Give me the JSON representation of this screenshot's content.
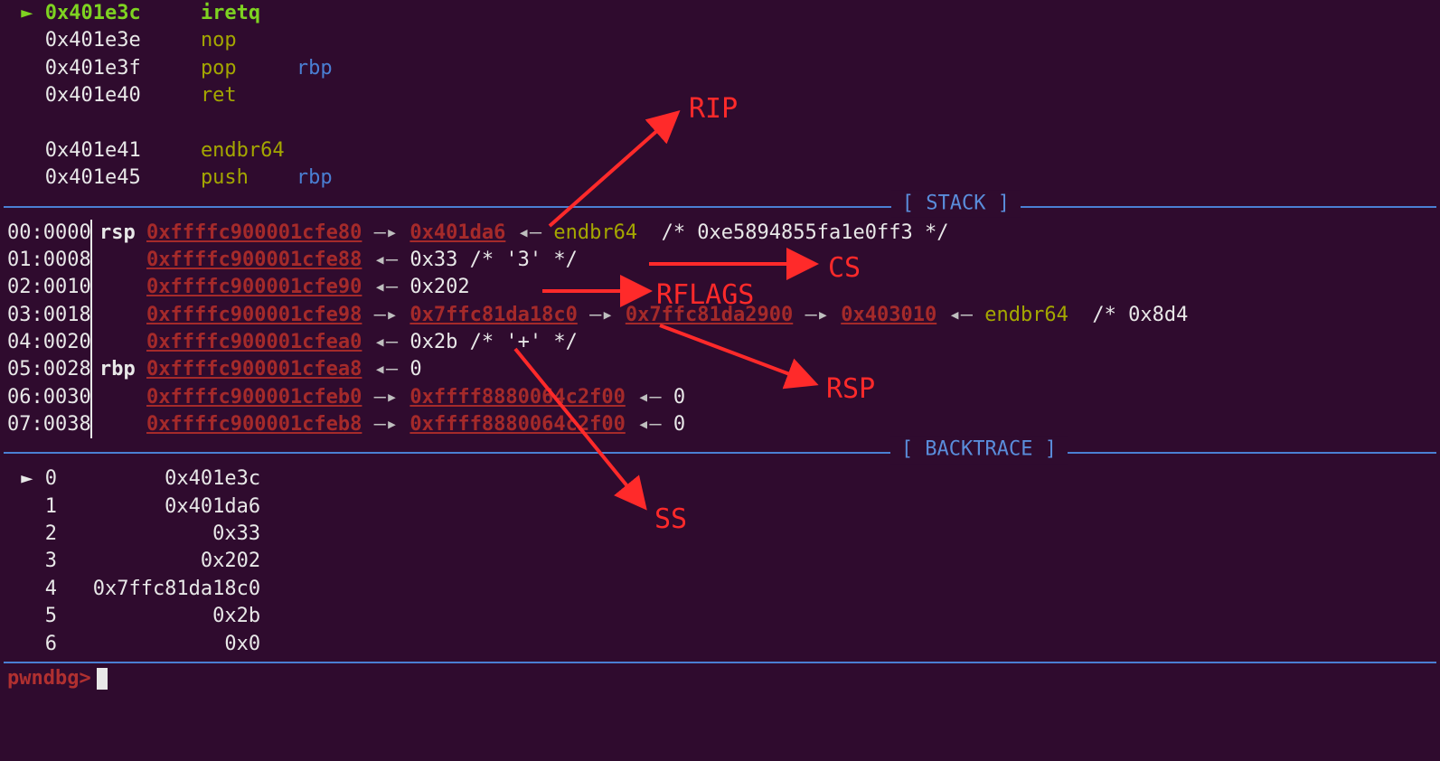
{
  "disasm": [
    {
      "marker": "►",
      "addr": "0x401e3c",
      "mnemonic": "iretq",
      "op": "",
      "current": true
    },
    {
      "marker": " ",
      "addr": "0x401e3e",
      "mnemonic": "nop",
      "op": "",
      "current": false
    },
    {
      "marker": " ",
      "addr": "0x401e3f",
      "mnemonic": "pop",
      "op": "rbp",
      "current": false
    },
    {
      "marker": " ",
      "addr": "0x401e40",
      "mnemonic": "ret",
      "op": "",
      "current": false
    },
    {
      "blank": true
    },
    {
      "marker": " ",
      "addr": "0x401e41",
      "mnemonic": "endbr64",
      "op": "",
      "current": false
    },
    {
      "marker": " ",
      "addr": "0x401e45",
      "mnemonic": "push",
      "op": "rbp",
      "current": false
    }
  ],
  "sections": {
    "stack_label": "[ STACK ]",
    "backtrace_label": "[ BACKTRACE ]"
  },
  "stack": [
    {
      "idx": "00:0000",
      "reg": "rsp",
      "addr": "0xffffc900001cfe80",
      "chain": [
        {
          "arrow": "—▸",
          "link": "0x401da6"
        },
        {
          "arrow": "◂—",
          "olive": "endbr64 ",
          "comment": " /* 0xe5894855fa1e0ff3 */"
        }
      ]
    },
    {
      "idx": "01:0008",
      "reg": "",
      "addr": "0xffffc900001cfe88",
      "chain": [
        {
          "arrow": "◂—",
          "text": "0x33 /* '3' */"
        }
      ]
    },
    {
      "idx": "02:0010",
      "reg": "",
      "addr": "0xffffc900001cfe90",
      "chain": [
        {
          "arrow": "◂—",
          "text": "0x202"
        }
      ]
    },
    {
      "idx": "03:0018",
      "reg": "",
      "addr": "0xffffc900001cfe98",
      "chain": [
        {
          "arrow": "—▸",
          "link": "0x7ffc81da18c0"
        },
        {
          "arrow": "—▸",
          "link": "0x7ffc81da2900"
        },
        {
          "arrow": "—▸",
          "link": "0x403010"
        },
        {
          "arrow": "◂—",
          "olive": "endbr64 ",
          "comment": " /* 0x8d4"
        }
      ]
    },
    {
      "idx": "04:0020",
      "reg": "",
      "addr": "0xffffc900001cfea0",
      "chain": [
        {
          "arrow": "◂—",
          "text": "0x2b /* '+' */"
        }
      ]
    },
    {
      "idx": "05:0028",
      "reg": "rbp",
      "addr": "0xffffc900001cfea8",
      "chain": [
        {
          "arrow": "◂—",
          "text": "0"
        }
      ]
    },
    {
      "idx": "06:0030",
      "reg": "",
      "addr": "0xffffc900001cfeb0",
      "chain": [
        {
          "arrow": "—▸",
          "link": "0xffff8880064c2f00"
        },
        {
          "arrow": "◂—",
          "text": "0"
        }
      ]
    },
    {
      "idx": "07:0038",
      "reg": "",
      "addr": "0xffffc900001cfeb8",
      "chain": [
        {
          "arrow": "—▸",
          "link": "0xffff8880064c2f00"
        },
        {
          "arrow": "◂—",
          "text": "0"
        }
      ]
    }
  ],
  "backtrace": [
    {
      "marker": "►",
      "idx": "0",
      "addr": "0x401e3c"
    },
    {
      "marker": " ",
      "idx": "1",
      "addr": "0x401da6"
    },
    {
      "marker": " ",
      "idx": "2",
      "addr": "0x33"
    },
    {
      "marker": " ",
      "idx": "3",
      "addr": "0x202"
    },
    {
      "marker": " ",
      "idx": "4",
      "addr": "0x7ffc81da18c0"
    },
    {
      "marker": " ",
      "idx": "5",
      "addr": "0x2b"
    },
    {
      "marker": " ",
      "idx": "6",
      "addr": "0x0"
    }
  ],
  "prompt": "pwndbg>",
  "annotations": {
    "rip": "RIP",
    "cs": "CS",
    "rflags": "RFLAGS",
    "rsp": "RSP",
    "ss": "SS"
  }
}
